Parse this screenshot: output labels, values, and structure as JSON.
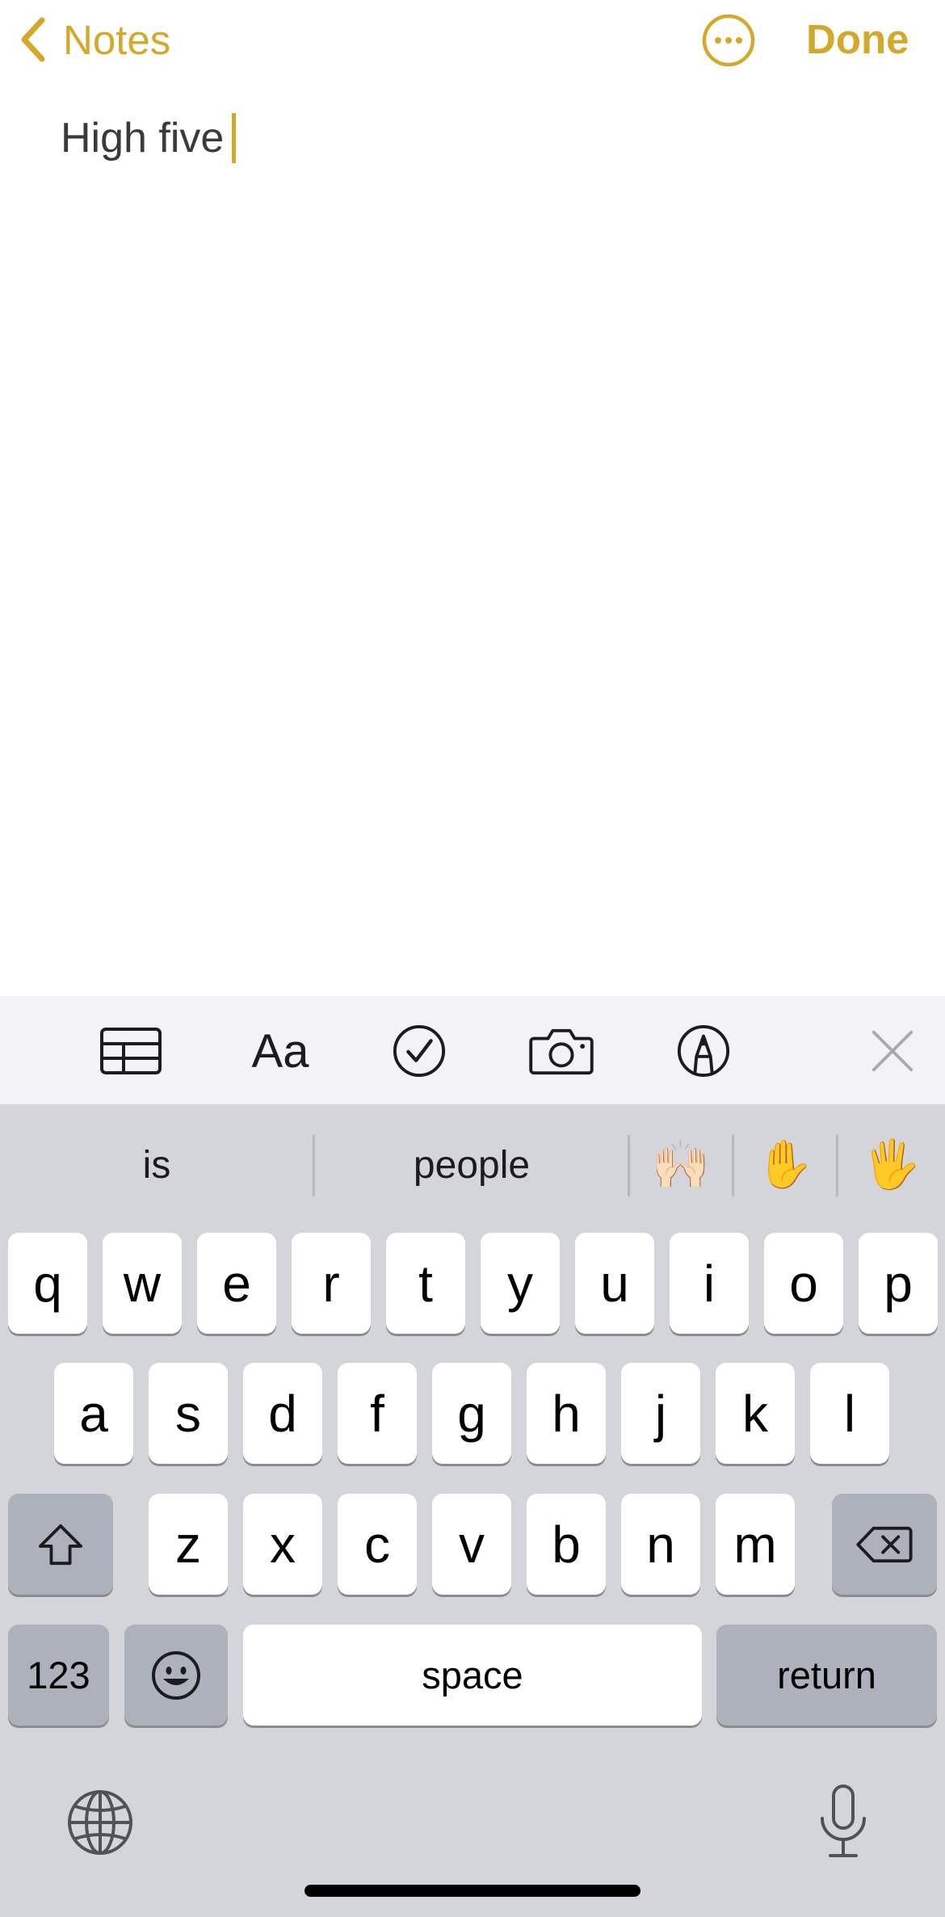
{
  "nav": {
    "back_label": "Notes",
    "done_label": "Done"
  },
  "note": {
    "text": "High five"
  },
  "toolbar": {
    "items": [
      "table-icon",
      "text-format-icon",
      "checklist-icon",
      "camera-icon",
      "markup-icon",
      "close-icon"
    ],
    "format_label": "Aa"
  },
  "keyboard": {
    "predictions": [
      "is",
      "people",
      "🙌🏻",
      "✋",
      "🖐"
    ],
    "row1": [
      "q",
      "w",
      "e",
      "r",
      "t",
      "y",
      "u",
      "i",
      "o",
      "p"
    ],
    "row2": [
      "a",
      "s",
      "d",
      "f",
      "g",
      "h",
      "j",
      "k",
      "l"
    ],
    "row3": [
      "z",
      "x",
      "c",
      "v",
      "b",
      "n",
      "m"
    ],
    "numbers_label": "123",
    "space_label": "space",
    "return_label": "return"
  },
  "colors": {
    "accent": "#d4a82a",
    "keyboard_bg": "#d3d5db",
    "toolbar_bg": "#f2f2f7",
    "dark_key": "#adb1bb"
  }
}
